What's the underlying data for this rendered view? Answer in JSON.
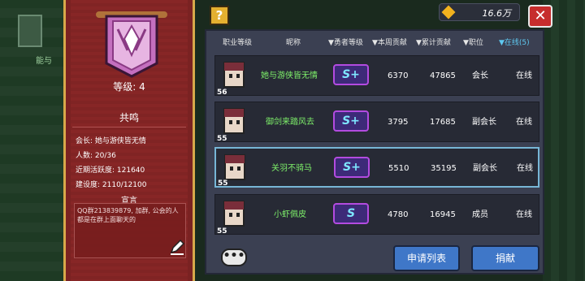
{
  "background": {
    "label": "能与"
  },
  "guild": {
    "level_label": "等级: 4",
    "name": "共鸣",
    "info": [
      "会长: 她与游侠皆无情",
      "人数: 20/36",
      "近期活跃度: 121640",
      "建设度: 2110/12100"
    ],
    "notice_title": "宣言",
    "notice_text": "QQ群213839879, 加群, 公会的人都是在群上面聊天的"
  },
  "topbar": {
    "help_label": "?",
    "gold_value": "16.6万",
    "close_label": "✕"
  },
  "table": {
    "headers": [
      {
        "label": "职业等级",
        "active": false
      },
      {
        "label": "昵称",
        "active": false
      },
      {
        "label": "▼勇者等级",
        "active": false
      },
      {
        "label": "▼本周贡献",
        "active": false
      },
      {
        "label": "▼累计贡献",
        "active": false
      },
      {
        "label": "▼职位",
        "active": false
      },
      {
        "label": "▼在线(5)",
        "active": true
      }
    ],
    "rows": [
      {
        "level": "56",
        "name": "她与游侠皆无情",
        "rank_badge": "S+",
        "weekly": "6370",
        "total": "47865",
        "role": "会长",
        "status": "在线",
        "selected": false
      },
      {
        "level": "55",
        "name": "御剑来踏风去",
        "rank_badge": "S+",
        "weekly": "3795",
        "total": "17685",
        "role": "副会长",
        "status": "在线",
        "selected": false
      },
      {
        "level": "55",
        "name": "关羽不骑马",
        "rank_badge": "S+",
        "weekly": "5510",
        "total": "35195",
        "role": "副会长",
        "status": "在线",
        "selected": true
      },
      {
        "level": "55",
        "name": "小虾佩皮",
        "rank_badge": "S",
        "weekly": "4780",
        "total": "16945",
        "role": "成员",
        "status": "在线",
        "selected": false
      }
    ]
  },
  "footer": {
    "chat_icon": "chat-bubble-icon",
    "apply_list_label": "申请列表",
    "donate_label": "捐献"
  },
  "colors": {
    "panel_red": "#7a2222",
    "name_green": "#7ef06a",
    "accent_blue": "#3f77c8",
    "active_header": "#5ec8f0"
  }
}
